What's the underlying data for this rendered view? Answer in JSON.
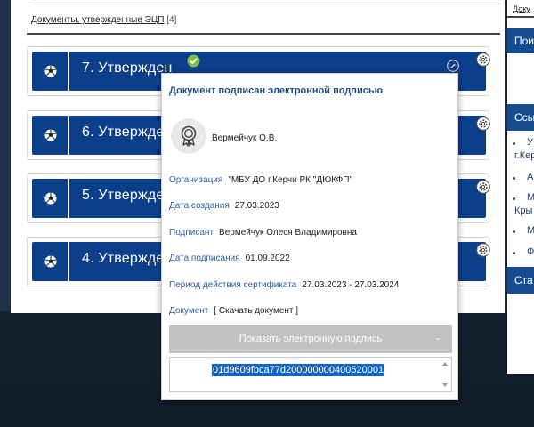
{
  "breadcrumb": {
    "link": "Документы, утвержденные ЭЦП",
    "count": "[4]"
  },
  "documents": [
    {
      "title": "7. Утвержден"
    },
    {
      "title": "6. Утвержден"
    },
    {
      "title": "5. Утвержден"
    },
    {
      "title": "4. Утвержден"
    }
  ],
  "right_column": {
    "top_link": "Доку",
    "heading_1": "Пои",
    "heading_2": "Ссы",
    "items": [
      "У",
      "г.Кер",
      "А",
      "М",
      "Кры",
      "М",
      "Ф"
    ],
    "heading_3": "Ста"
  },
  "popup": {
    "title": "Документ подписан электронной подписью",
    "signer_short": "Вермейчук О.В.",
    "fields": {
      "org_label": "Организация",
      "org_value": "\"МБУ ДО г.Керчи РК \"ДЮКФП\"",
      "created_label": "Дата создания",
      "created_value": "27.03.2023",
      "signer_label": "Подписант",
      "signer_value": "Вермейчук Олеся Владимировна",
      "signed_label": "Дата подписания",
      "signed_value": "01.09.2022",
      "period_label": "Период действия сертификата",
      "period_value": "27.03.2023 - 27.03.2024",
      "doc_label": "Документ",
      "doc_link": "[ Скачать документ ]"
    },
    "show_signature_button": "Показать электронную подпись",
    "collapse_symbol": "-",
    "signature_value": "01d9609fbca77d200000000400520001"
  },
  "colors": {
    "doc_bar": "#0b3f8a",
    "label_blue": "#2a5f9a",
    "selection": "#1565c6",
    "button_gray": "#c2c2c2"
  }
}
